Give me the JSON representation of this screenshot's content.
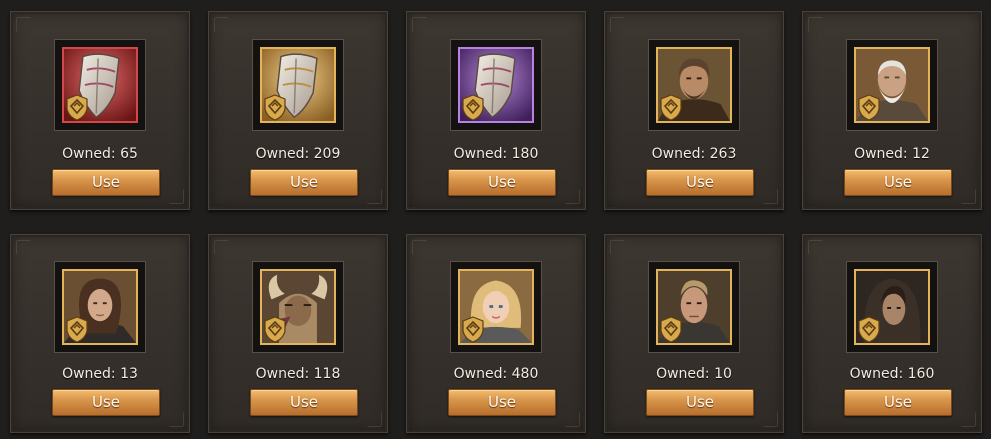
{
  "items": [
    {
      "kind": "shield",
      "tier": "red",
      "owned": "Owned: 65",
      "use": "Use"
    },
    {
      "kind": "shield",
      "tier": "gold",
      "owned": "Owned: 209",
      "use": "Use"
    },
    {
      "kind": "shield",
      "tier": "purple",
      "owned": "Owned: 180",
      "use": "Use"
    },
    {
      "kind": "portrait",
      "hero": "bearded-man",
      "owned": "Owned: 263",
      "use": "Use"
    },
    {
      "kind": "portrait",
      "hero": "old-sage",
      "owned": "Owned: 12",
      "use": "Use"
    },
    {
      "kind": "portrait",
      "hero": "woman-brown-hair",
      "owned": "Owned: 13",
      "use": "Use"
    },
    {
      "kind": "portrait",
      "hero": "horned-beast",
      "owned": "Owned: 118",
      "use": "Use"
    },
    {
      "kind": "portrait",
      "hero": "blonde-girl",
      "owned": "Owned: 480",
      "use": "Use"
    },
    {
      "kind": "portrait",
      "hero": "scarred-warrior",
      "owned": "Owned: 10",
      "use": "Use"
    },
    {
      "kind": "portrait",
      "hero": "hooded-youth",
      "owned": "Owned: 160",
      "use": "Use"
    }
  ],
  "colors": {
    "accent": "#e4b45a",
    "button": "#d7954a",
    "card": "#3a342e",
    "background": "#1f1e1c"
  }
}
